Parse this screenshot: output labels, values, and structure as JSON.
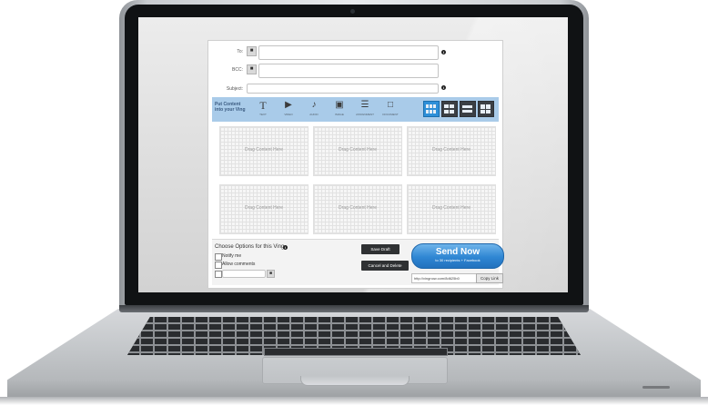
{
  "form": {
    "to_label": "To:",
    "bcc_label": "BCC:",
    "subject_label": "Subject:",
    "to_value": "",
    "bcc_value": "",
    "subject_value": ""
  },
  "toolbar": {
    "put_content_label": "Put Content into your Ving",
    "tools": [
      {
        "label": "TEXT",
        "icon": "text-icon"
      },
      {
        "label": "VIDEO",
        "icon": "video-icon"
      },
      {
        "label": "AUDIO",
        "icon": "audio-icon"
      },
      {
        "label": "IMAGE",
        "icon": "image-icon"
      },
      {
        "label": "ASSIGNMENT",
        "icon": "assignment-icon"
      },
      {
        "label": "DOCUMENT",
        "icon": "document-icon"
      }
    ],
    "layouts": [
      "layout-grid-six",
      "layout-grid-four",
      "layout-grid-two",
      "layout-grid-quad"
    ],
    "selected_layout": "layout-grid-six"
  },
  "slots": [
    "Drag Content Here",
    "Drag Content Here",
    "Drag Content Here",
    "Drag Content Here",
    "Drag Content Here",
    "Drag Content Here"
  ],
  "options": {
    "title": "Choose Options for this Ving",
    "notify_label": "Notify me",
    "allow_comments_label": "Allow comments",
    "extra_value": ""
  },
  "actions": {
    "save_draft": "Save Draft",
    "cancel_delete": "Cancel and Delete",
    "send_now": "Send Now",
    "send_sub": "to 30 recipients + Facebook",
    "link_value": "http://vingnow.com/8d625b0",
    "copy_link": "Copy Link"
  },
  "colors": {
    "accent_blue": "#2f86d3",
    "toolbar_bg": "#a9cbe9",
    "dark_button": "#2f3133"
  }
}
